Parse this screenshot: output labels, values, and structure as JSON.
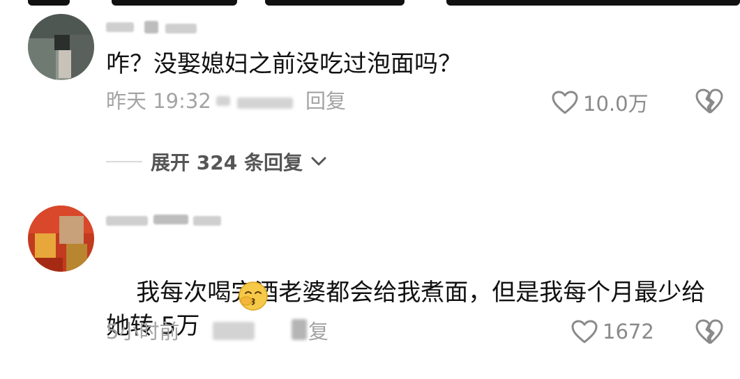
{
  "comments": [
    {
      "text": "咋？没娶媳妇之前没吃过泡面吗？",
      "time": "昨天 19:32",
      "reply_label": "回复",
      "likes": "10.0万"
    },
    {
      "text": "我每次喝完酒老婆都会给我煮面，但是我每个月最少给她转 5万",
      "time": "5小时前",
      "reply_label": "复",
      "likes": "1672",
      "emoji": "kissing-face-emoji"
    }
  ],
  "expand_replies": {
    "label": "展开 324 条回复",
    "icon": "chevron-down-icon"
  },
  "colors": {
    "text": "#111111",
    "meta": "#a3a3a3",
    "icon": "#8a8a8a",
    "divider": "#d9d9d9"
  }
}
